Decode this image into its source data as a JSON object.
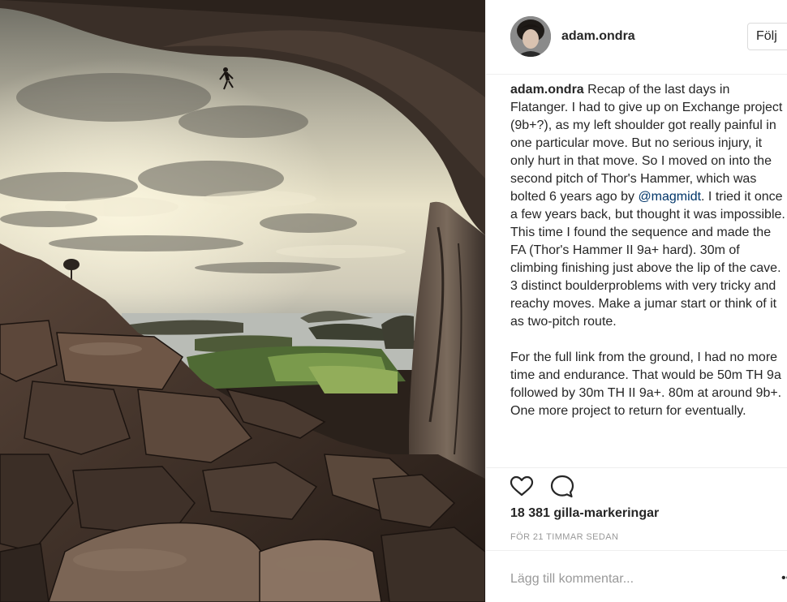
{
  "post": {
    "username": "adam.ondra",
    "follow_label": "Följ",
    "caption": {
      "username": "adam.ondra",
      "part1": " Recap of the last days in Flatanger. I had to give up on Exchange project (9b+?), as my left shoulder got really painful in one particular move. But no serious injury, it only hurt in that move. So I moved on into the second pitch of Thor's Hammer, which was bolted 6 years ago by ",
      "mention": "@magmidt",
      "part2": ". I tried it once a few years back, but thought it was impossible. This time I found the sequence and made the FA (Thor's Hammer II 9a+ hard). 30m of climbing finishing just above the lip of the cave. 3 distinct boulderproblems with very tricky and reachy moves. Make a jumar start or think of it as two-pitch route.",
      "paragraph2": "For the full link from the ground, I had no more time and endurance. That would be 50m TH 9a followed by 30m TH II 9a+. 80m at around 9b+. One more project to return for eventually."
    },
    "likes": "18 381 gilla-markeringar",
    "time_ago": "FÖR 21 TIMMAR SEDAN",
    "comment_placeholder": "Lägg till kommentar...",
    "more_glyph": "•••"
  },
  "icons": {
    "like": "heart-icon",
    "comment": "comment-bubble-icon"
  }
}
